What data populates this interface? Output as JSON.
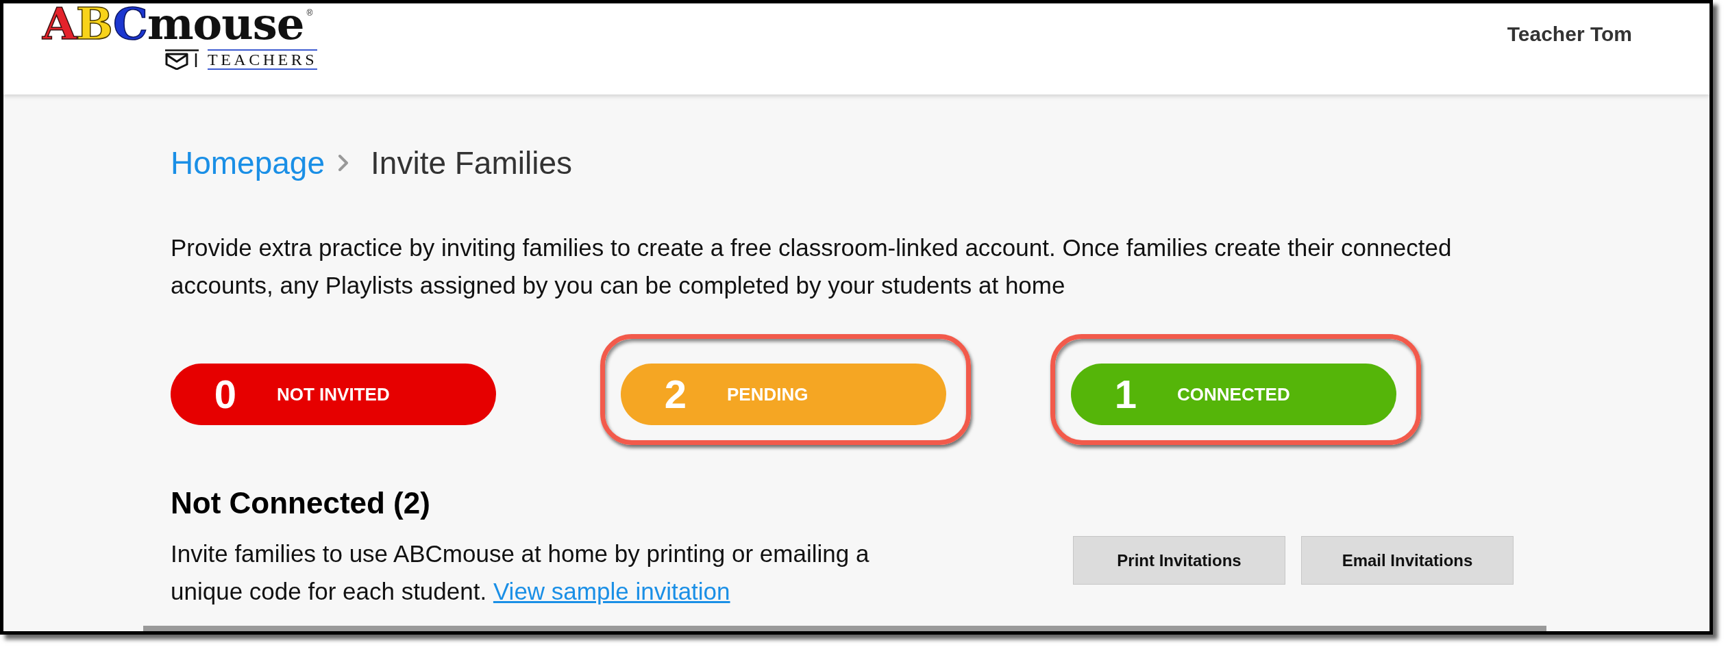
{
  "header": {
    "logo": {
      "wordmark": "ABCmouse",
      "registered_mark": "®",
      "subtitle": "TEACHERS"
    },
    "user_name": "Teacher Tom"
  },
  "breadcrumb": [
    {
      "label": "Homepage",
      "kind": "link"
    },
    {
      "label": "Invite Families",
      "kind": "current"
    }
  ],
  "intro": "Provide extra practice by inviting families to create a free classroom-linked account. Once families create their connected accounts, any Playlists assigned by you can be completed by your students at home",
  "statuses": [
    {
      "count": "0",
      "label": "NOT INVITED",
      "color": "#e60000",
      "highlighted": false
    },
    {
      "count": "2",
      "label": "PENDING",
      "color": "#f5a623",
      "highlighted": true
    },
    {
      "count": "1",
      "label": "CONNECTED",
      "color": "#55b509",
      "highlighted": true
    }
  ],
  "section": {
    "heading": "Not Connected (2)",
    "description": "Invite families to use ABCmouse at home by printing or emailing a unique code for each student.",
    "link": "View sample invitation",
    "buttons": [
      "Print Invitations",
      "Email Invitations"
    ]
  }
}
